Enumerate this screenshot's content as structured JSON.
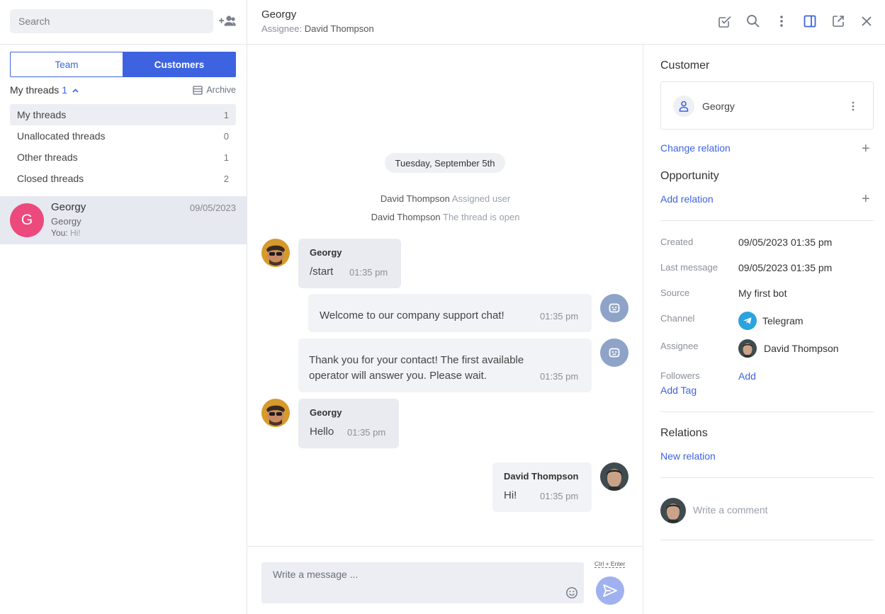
{
  "left": {
    "search_placeholder": "Search",
    "tabs": {
      "team": "Team",
      "customers": "Customers"
    },
    "threads_header": {
      "title": "My threads",
      "count": "1",
      "archive_label": "Archive"
    },
    "thread_filters": [
      {
        "label": "My threads",
        "count": "1"
      },
      {
        "label": "Unallocated threads",
        "count": "0"
      },
      {
        "label": "Other threads",
        "count": "1"
      },
      {
        "label": "Closed threads",
        "count": "2"
      }
    ],
    "conversation": {
      "initial": "G",
      "name": "Georgy",
      "date": "09/05/2023",
      "subtitle": "Georgy",
      "last_prefix": "You:",
      "last_message": "Hi!"
    }
  },
  "header": {
    "title": "Georgy",
    "assignee_label": "Assignee:",
    "assignee_name": "David Thompson"
  },
  "chat": {
    "date_separator": "Tuesday, September 5th",
    "system_events": [
      {
        "actor": "David Thompson",
        "text": "Assigned user"
      },
      {
        "actor": "David Thompson",
        "text": "The thread is open"
      }
    ],
    "messages": [
      {
        "author": "Georgy",
        "text": "/start",
        "time": "01:35 pm"
      },
      {
        "author": "",
        "text": "Welcome to our company support chat!",
        "time": "01:35 pm"
      },
      {
        "author": "",
        "text_line1": "Thank you for your contact! The first available",
        "text_line2": "operator will answer you. Please wait.",
        "time": "01:35 pm"
      },
      {
        "author": "Georgy",
        "text": "Hello",
        "time": "01:35 pm"
      },
      {
        "author": "David Thompson",
        "text": "Hi!",
        "time": "01:35 pm"
      }
    ],
    "composer": {
      "placeholder": "Write a message ...",
      "shortcut_hint": "Ctrl + Enter"
    }
  },
  "right": {
    "customer_heading": "Customer",
    "customer_name": "Georgy",
    "change_relation": "Change relation",
    "opportunity_heading": "Opportunity",
    "add_relation": "Add relation",
    "details": {
      "created_label": "Created",
      "created_value": "09/05/2023 01:35 pm",
      "last_message_label": "Last message",
      "last_message_value": "09/05/2023 01:35 pm",
      "source_label": "Source",
      "source_value": "My first bot",
      "channel_label": "Channel",
      "channel_value": "Telegram",
      "assignee_label": "Assignee",
      "assignee_value": "David Thompson",
      "followers_label": "Followers",
      "followers_action": "Add"
    },
    "add_tag": "Add Tag",
    "relations_heading": "Relations",
    "new_relation": "New relation",
    "comment_placeholder": "Write a comment"
  },
  "colors": {
    "accent": "#3d63e0",
    "conversation_avatar": "#ec4a7c",
    "bot_avatar": "#8ea3c7",
    "telegram": "#2aa3df",
    "send_button": "#9fb1f0"
  },
  "icons": {
    "add_user": "add-user-icon",
    "archive": "archive-icon",
    "header_actions": [
      "task-check-icon",
      "search-icon",
      "more-vertical-icon",
      "panel-toggle-icon",
      "open-external-icon",
      "close-icon"
    ],
    "bot": "bot-icon",
    "customer": "person-icon",
    "channel": "telegram-icon",
    "emoji": "emoji-icon",
    "send": "send-icon"
  }
}
